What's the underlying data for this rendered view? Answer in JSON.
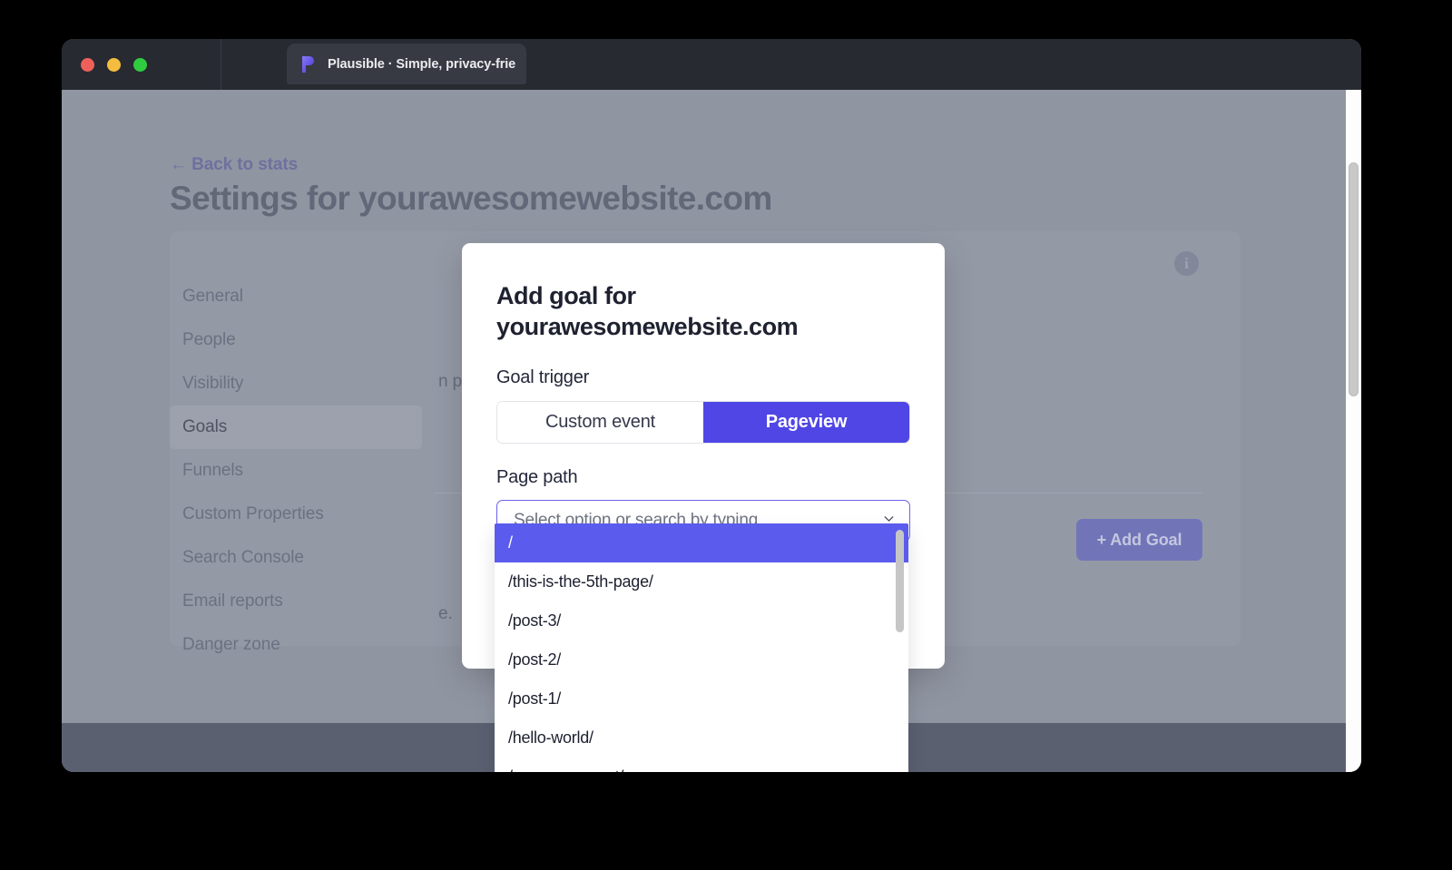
{
  "browser": {
    "tab_title": "Plausible · Simple, privacy-friend",
    "favicon_name": "plausible-logo-icon",
    "traffic_lights": [
      "close",
      "minimize",
      "maximize"
    ]
  },
  "page": {
    "back_link": "← Back to stats",
    "title": "Settings for yourawesomewebsite.com",
    "sidebar": {
      "items": [
        {
          "label": "General",
          "active": false
        },
        {
          "label": "People",
          "active": false
        },
        {
          "label": "Visibility",
          "active": false
        },
        {
          "label": "Goals",
          "active": true
        },
        {
          "label": "Funnels",
          "active": false
        },
        {
          "label": "Custom Properties",
          "active": false
        },
        {
          "label": "Search Console",
          "active": false
        },
        {
          "label": "Email reports",
          "active": false
        },
        {
          "label": "Danger zone",
          "active": false
        }
      ]
    },
    "content": {
      "description_fragment": "n page, submitting a form, etc.",
      "tail_fragment": "e.",
      "add_goal_button": "+ Add Goal",
      "info_icon": "info-icon",
      "info_glyph": "i"
    }
  },
  "modal": {
    "title": "Add goal for yourawesomewebsite.com",
    "goal_trigger_label": "Goal trigger",
    "trigger_options": [
      {
        "label": "Custom event",
        "active": false
      },
      {
        "label": "Pageview",
        "active": true
      }
    ],
    "page_path_label": "Page path",
    "select": {
      "placeholder": "Select option or search by typing",
      "value": "",
      "chevron_icon": "chevron-down-icon"
    },
    "dropdown_options": [
      {
        "label": "/",
        "selected": true
      },
      {
        "label": "/this-is-the-5th-page/",
        "selected": false
      },
      {
        "label": "/post-3/",
        "selected": false
      },
      {
        "label": "/post-2/",
        "selected": false
      },
      {
        "label": "/post-1/",
        "selected": false
      },
      {
        "label": "/hello-world/",
        "selected": false
      },
      {
        "label": "/evergreen-post/",
        "selected": false
      }
    ]
  },
  "colors": {
    "accent": "#4f46e5",
    "dropdown_highlight": "#5b5bee",
    "overlay": "#9095a2",
    "titlebar": "#272a31",
    "footer": "#5b6071"
  }
}
